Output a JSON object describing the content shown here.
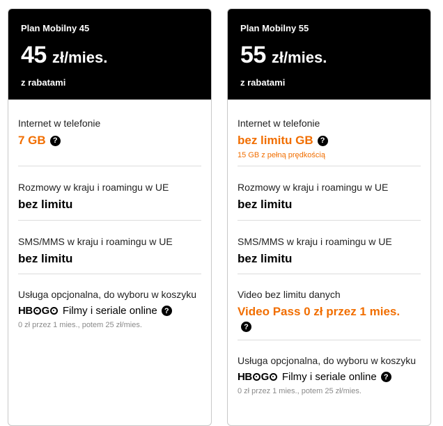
{
  "cards": [
    {
      "plan_name": "Plan Mobilny 45",
      "price": "45",
      "unit": "zł/mies.",
      "note": "z rabatami",
      "internet": {
        "label": "Internet w telefonie",
        "value": "7 GB"
      },
      "calls": {
        "label": "Rozmowy w kraju i roamingu w UE",
        "value": "bez limitu"
      },
      "sms": {
        "label": "SMS/MMS w kraju i roamingu w UE",
        "value": "bez limitu"
      },
      "optional": {
        "label": "Usługa opcjonalna, do wyboru w koszyku",
        "logo": "HBO GO",
        "text": "Filmy i seriale online",
        "note": "0 zł przez 1 mies., potem 25 zł/mies."
      }
    },
    {
      "plan_name": "Plan Mobilny 55",
      "price": "55",
      "unit": "zł/mies.",
      "note": "z rabatami",
      "internet": {
        "label": "Internet w telefonie",
        "value": "bez limitu GB",
        "sub": "15 GB z pełną prędkością"
      },
      "calls": {
        "label": "Rozmowy w kraju i roamingu w UE",
        "value": "bez limitu"
      },
      "sms": {
        "label": "SMS/MMS w kraju i roamingu w UE",
        "value": "bez limitu"
      },
      "video": {
        "label": "Video bez limitu danych",
        "value": "Video Pass 0 zł przez 1 mies."
      },
      "optional": {
        "label": "Usługa opcjonalna, do wyboru w koszyku",
        "logo": "HBO GO",
        "text": "Filmy i seriale online",
        "note": "0 zł przez 1 mies., potem 25 zł/mies."
      }
    }
  ],
  "colors": {
    "accent": "#f16e00",
    "header_bg": "#000000"
  },
  "icons": {
    "help": "question-circle-icon"
  }
}
